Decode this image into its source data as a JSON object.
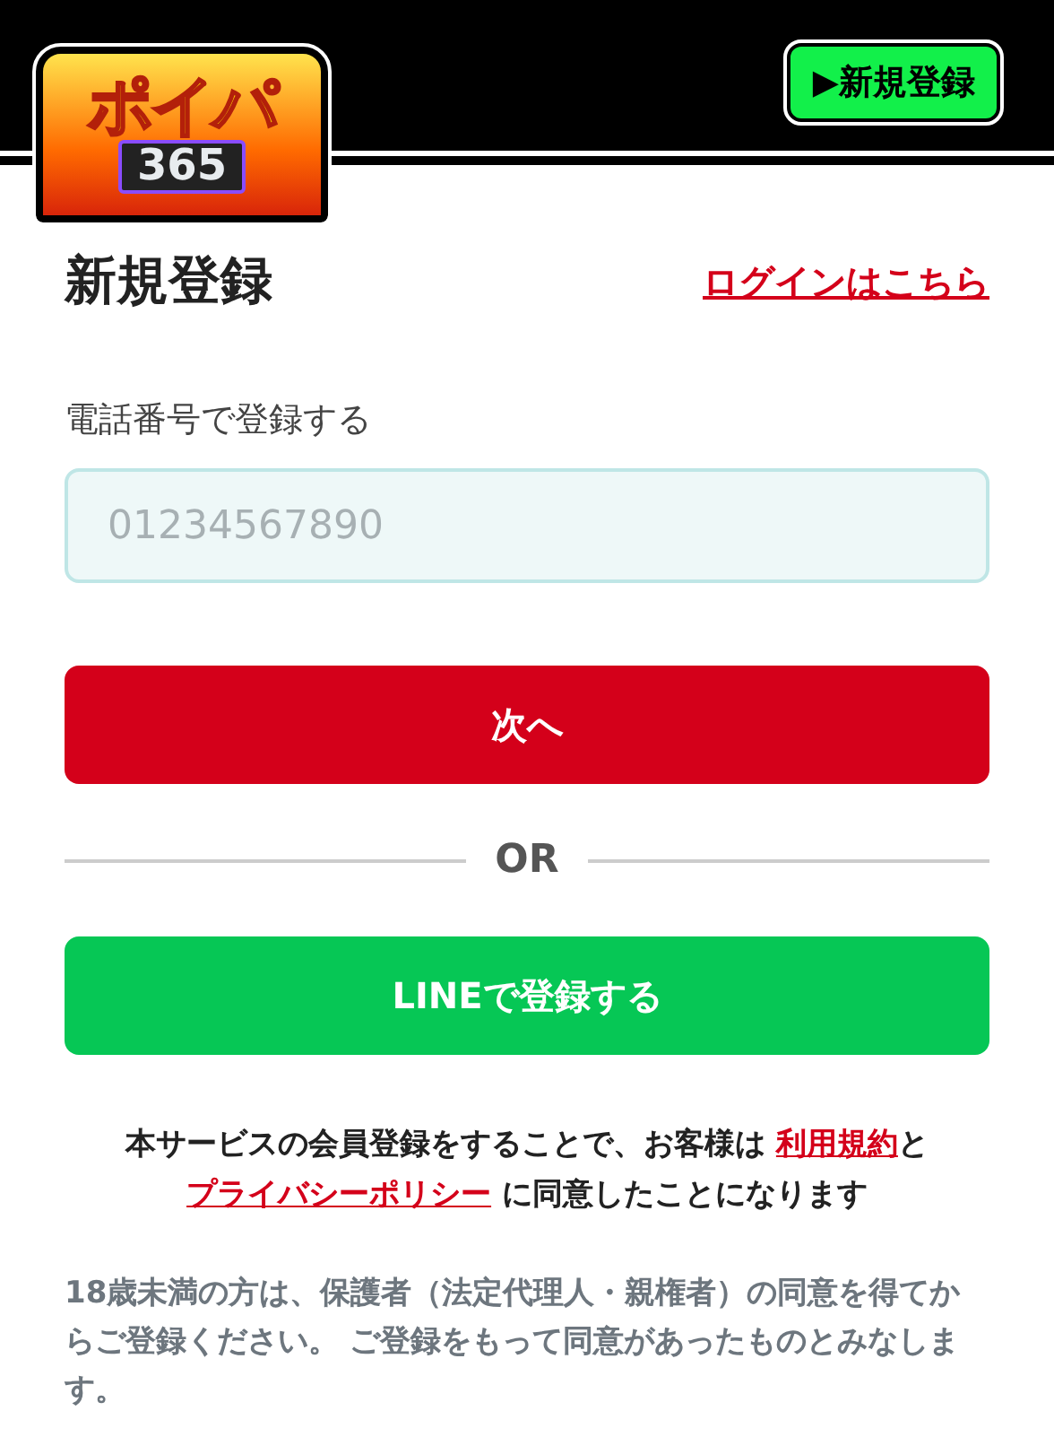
{
  "header": {
    "logo": {
      "title": "ポイパ",
      "number": "365"
    },
    "signup_button": {
      "icon": "▶",
      "label": "新規登録"
    }
  },
  "form": {
    "title": "新規登録",
    "login_link": "ログインはこちら",
    "phone_label": "電話番号で登録する",
    "phone_field": {
      "placeholder": "01234567890"
    },
    "next_button": "次へ",
    "divider": "OR",
    "line_button": "LINEで登録する"
  },
  "agreement": {
    "before": "本サービスの会員登録をすることで、お客様は ",
    "terms_link": "利用規約",
    "middle": "と",
    "privacy_link": "プライバシーポリシー",
    "after": " に同意したことになります"
  },
  "minor_notice": "18歳未満の方は、保護者（法定代理人・親権者）の同意を得てからご登録ください。 ご登録をもって同意があったものとみなします。"
}
